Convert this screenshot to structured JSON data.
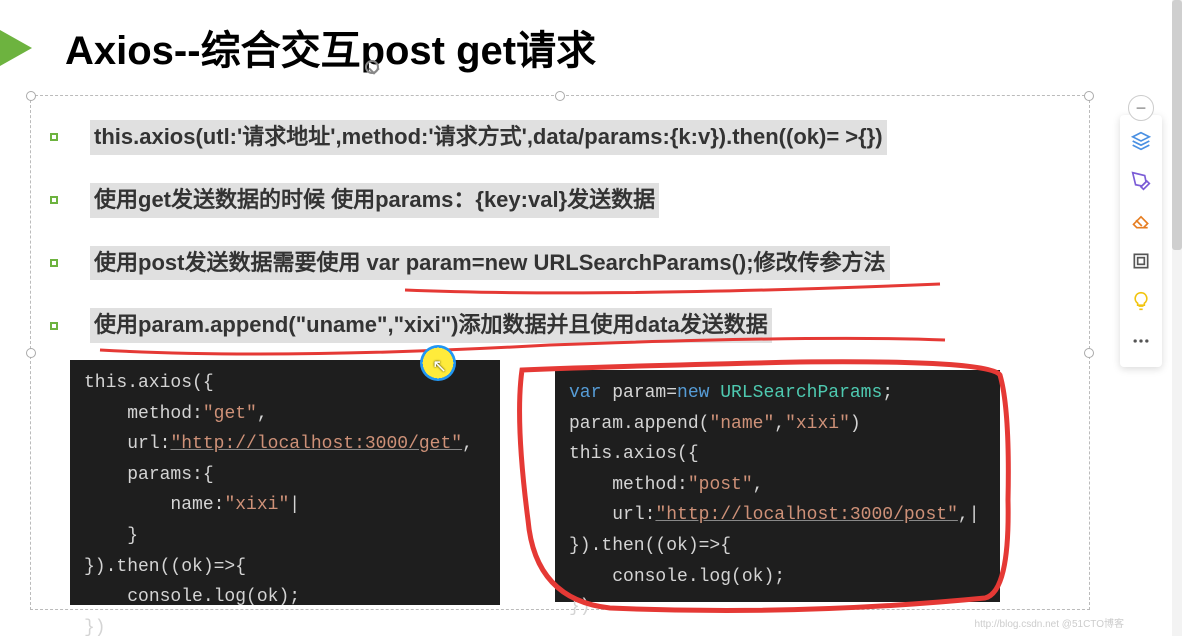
{
  "title": "Axios--综合交互post get请求",
  "bullets": [
    "this.axios(utl:'请求地址',method:'请求方式',data/params:{k:v}).then((ok)= >{})",
    "使用get发送数据的时候 使用params：{key:val}发送数据",
    "使用post发送数据需要使用 var param=new URLSearchParams();修改传参方法",
    "使用param.append(\"uname\",\"xixi\")添加数据并且使用data发送数据"
  ],
  "code_left": {
    "lines": [
      {
        "raw": "this.axios({"
      },
      {
        "indent": 1,
        "parts": [
          [
            "pale",
            "method:"
          ],
          [
            "str",
            "\"get\""
          ],
          [
            "pale",
            ","
          ]
        ]
      },
      {
        "indent": 1,
        "parts": [
          [
            "pale",
            "url:"
          ],
          [
            "str url-u",
            "\"http://localhost:3000/get\""
          ],
          [
            "pale",
            ","
          ]
        ]
      },
      {
        "indent": 1,
        "parts": [
          [
            "pale",
            "params:{"
          ]
        ]
      },
      {
        "indent": 2,
        "parts": [
          [
            "pale",
            "name:"
          ],
          [
            "str",
            "\"xixi\""
          ]
        ],
        "cursor": true
      },
      {
        "indent": 1,
        "raw": "}"
      },
      {
        "raw": "}).then((ok)=>{"
      },
      {
        "indent": 1,
        "raw": "console.log(ok);"
      },
      {
        "raw": "})"
      }
    ]
  },
  "code_right": {
    "lines": [
      {
        "parts": [
          [
            "kw",
            "var"
          ],
          [
            "pale",
            " param="
          ],
          [
            "newkw",
            "new"
          ],
          [
            "pale",
            " "
          ],
          [
            "typ",
            "URLSearchParams"
          ],
          [
            "pale",
            ";"
          ]
        ]
      },
      {
        "parts": [
          [
            "pale",
            "param.append("
          ],
          [
            "str",
            "\"name\""
          ],
          [
            "pale",
            ","
          ],
          [
            "str",
            "\"xixi\""
          ],
          [
            "pale",
            ")"
          ]
        ]
      },
      {
        "raw": "this.axios({"
      },
      {
        "indent": 1,
        "parts": [
          [
            "pale",
            "method:"
          ],
          [
            "str",
            "\"post\""
          ],
          [
            "pale",
            ","
          ]
        ]
      },
      {
        "indent": 1,
        "parts": [
          [
            "pale",
            "url:"
          ],
          [
            "str url-u",
            "\"http://localhost:3000/post\""
          ],
          [
            "pale",
            ",|"
          ]
        ]
      },
      {
        "raw": "}).then((ok)=>{"
      },
      {
        "indent": 1,
        "raw": "console.log(ok);"
      },
      {
        "raw": "})"
      }
    ]
  },
  "toolbar": {
    "minus": "−",
    "items": [
      "layers-icon",
      "pen-icon",
      "eraser-icon",
      "frame-icon",
      "bulb-icon",
      "more-icon"
    ]
  },
  "watermark": "http://blog.csdn.net @51CTO博客"
}
